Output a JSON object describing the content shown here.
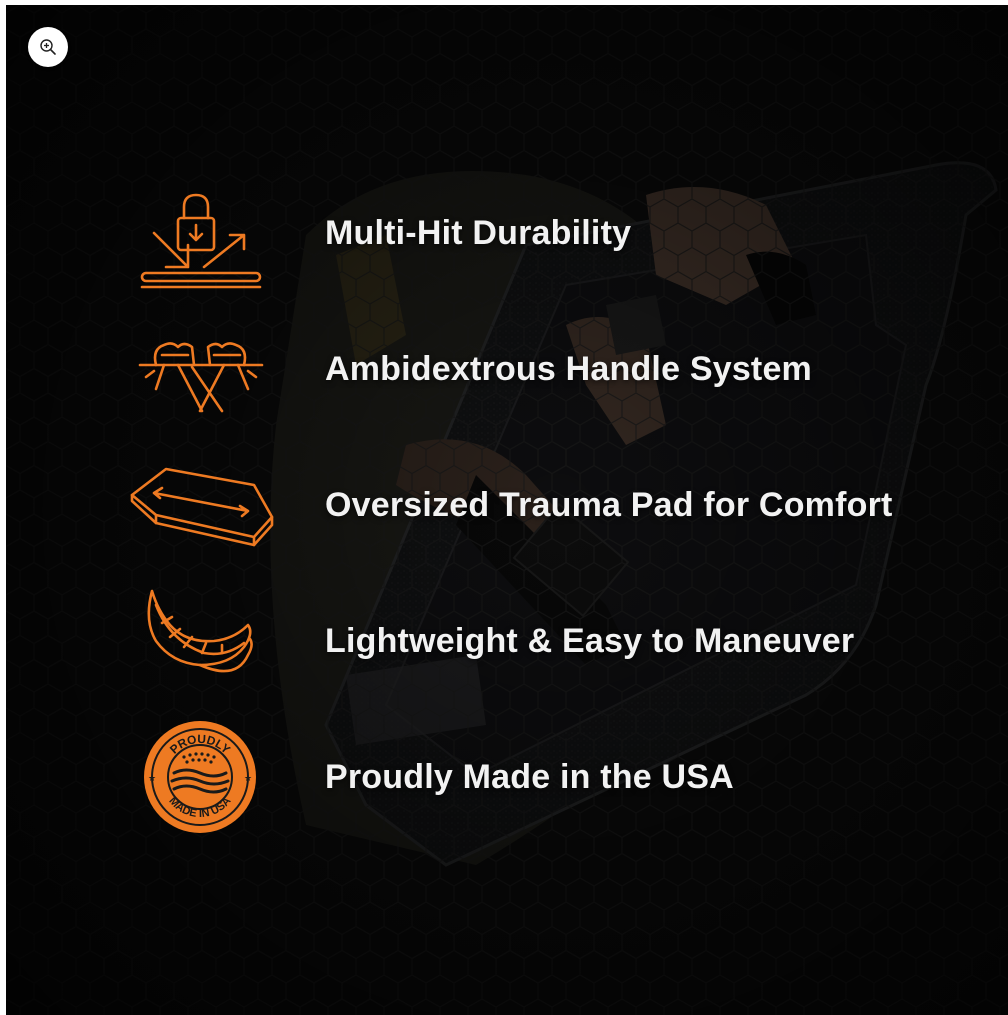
{
  "zoom": {
    "icon": "zoom-in-icon"
  },
  "theme": {
    "accent": "#ee7a22",
    "text": "#f2f2f2",
    "background": "#111111"
  },
  "features": [
    {
      "label": "Multi-Hit Durability",
      "icon": "padlock-impact-icon"
    },
    {
      "label": "Ambidextrous Handle System",
      "icon": "gripping-fists-icon"
    },
    {
      "label": "Oversized Trauma Pad for Comfort",
      "icon": "trauma-pad-icon"
    },
    {
      "label": "Lightweight & Easy to Maneuver",
      "icon": "feather-icon"
    },
    {
      "label": "Proudly Made in the USA",
      "icon": "made-in-usa-badge-icon"
    }
  ],
  "badge": {
    "top_text": "PROUDLY",
    "bottom_text": "MADE IN USA"
  }
}
